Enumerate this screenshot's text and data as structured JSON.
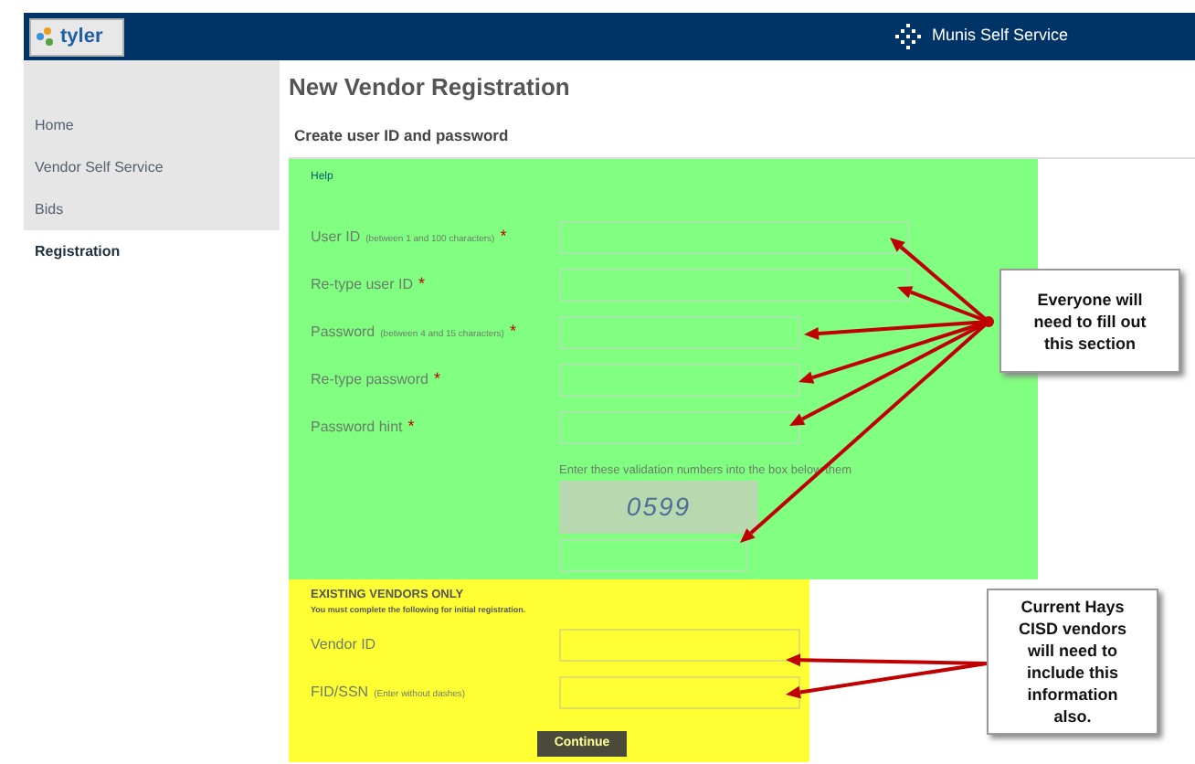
{
  "header": {
    "logo": "tyler",
    "title": "Munis Self Service"
  },
  "sidebar": {
    "items": [
      {
        "label": "Home",
        "selected": false
      },
      {
        "label": "Vendor Self Service",
        "selected": false
      },
      {
        "label": "Bids",
        "selected": false
      },
      {
        "label": "Registration",
        "selected": true
      }
    ]
  },
  "page": {
    "title": "New Vendor Registration",
    "subtitle": "Create user ID and password"
  },
  "account_section": {
    "help_link": "Help",
    "fields": [
      {
        "label": "User ID",
        "hint": "(between 1 and 100 characters)",
        "mark": "*"
      },
      {
        "label": "Re-type user ID",
        "mark": "*"
      },
      {
        "label": "Password",
        "hint": "(between 4 and 15 characters)",
        "mark": "*"
      },
      {
        "label": "Re-type password",
        "mark": "*"
      },
      {
        "label": "Password hint",
        "mark": "*"
      }
    ],
    "captcha_prompt": "Enter these validation numbers into the box below them",
    "captcha": "0599"
  },
  "vendor_section": {
    "heading": "EXISTING VENDORS ONLY",
    "note": "You must complete the following for initial registration.",
    "fields": [
      {
        "label": "Vendor ID"
      },
      {
        "label": "FID/SSN",
        "hint": "(Enter without dashes)"
      }
    ],
    "button": "Continue"
  },
  "callouts": [
    {
      "text": "Everyone will need to fill out this section"
    },
    {
      "text": "Current Hays CISD vendors will need to include this information also."
    }
  ]
}
